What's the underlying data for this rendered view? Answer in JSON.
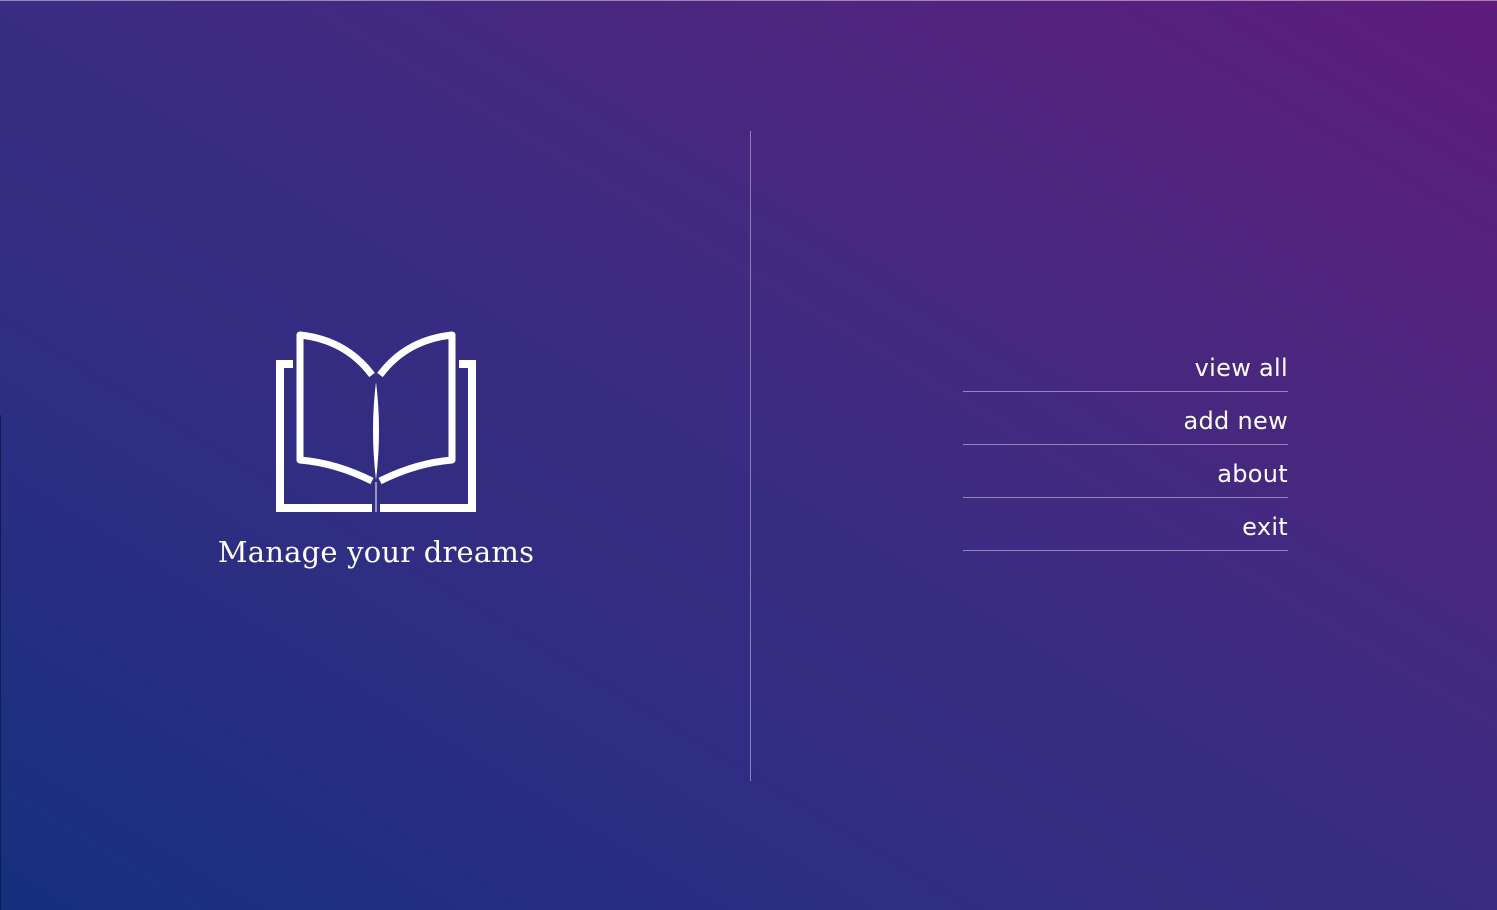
{
  "brand": {
    "logo_icon": "open-book-icon",
    "tagline": "Manage your dreams"
  },
  "menu": {
    "items": [
      {
        "label": "view all"
      },
      {
        "label": "add new"
      },
      {
        "label": "about"
      },
      {
        "label": "exit"
      }
    ]
  },
  "colors": {
    "gradient_bottom_left": "#15307e",
    "gradient_top_right": "#5e1b7a",
    "text": "#ffffff"
  }
}
